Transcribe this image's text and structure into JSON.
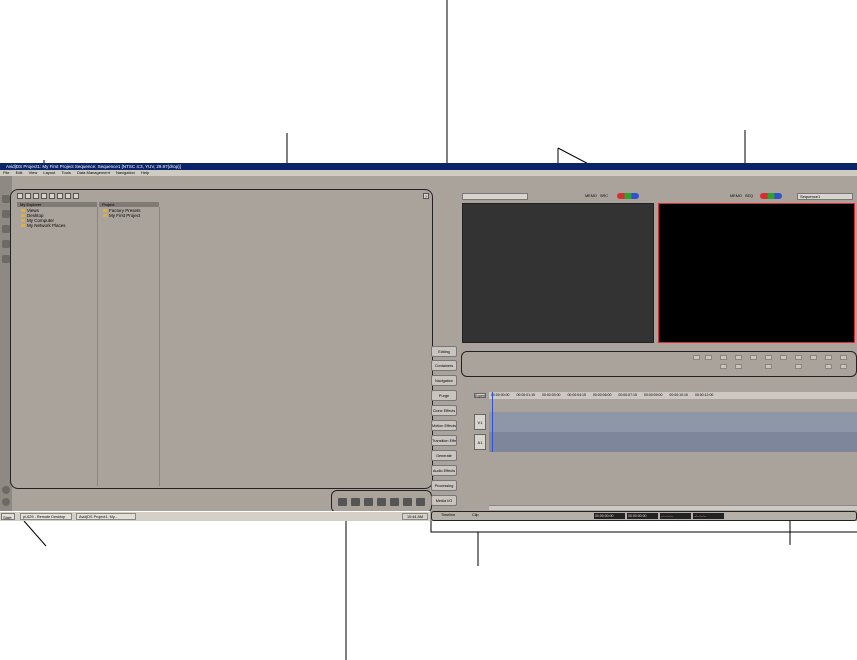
{
  "window": {
    "title": "Avid|DS Project1: My First Project   Sequence: Sequence1   [NTSC 4:3, YUV, 29.97(drop)]"
  },
  "menu": [
    "File",
    "Edit",
    "View",
    "Layout",
    "Tools",
    "Data Management",
    "Navigation",
    "Help"
  ],
  "project_panel": {
    "columns": [
      "My Explorer",
      "Project"
    ],
    "explorer_items": [
      "Views",
      "Desktop",
      "My Computer",
      "My Network Places"
    ],
    "project_items": [
      "Factory Presets",
      "My First Project"
    ],
    "help_label": "?"
  },
  "command_buttons": [
    "Editing",
    "Containers",
    "Navigation",
    "Purge",
    "Clone Effects",
    "Motion Effects",
    "Transition Effects",
    "Generate",
    "Audio Effects",
    "Processing",
    "Media I/O"
  ],
  "monitors": {
    "sequence_name": "Sequence1",
    "header_labels": [
      "MEMO",
      "SRC",
      "MEMO",
      "SEQ"
    ]
  },
  "timeline": {
    "expert_label": "Expert",
    "tracks": [
      "V1",
      "A1"
    ],
    "ruler_timecodes": [
      "00:00:00:00",
      "00:00:01:15",
      "00:00:03:00",
      "00:00:04:15",
      "00:00:06:00",
      "00:00:07:15",
      "00:00:09:00",
      "00:00:10:15",
      "00:00:12:00"
    ],
    "bottom_tabs": [
      "Timeline",
      "Clip"
    ],
    "timecodes": [
      "00:00:00:00",
      "00:00:00:00",
      "--:--:--:--",
      "--:--:--:--"
    ]
  },
  "taskbar": {
    "start_label": "Start",
    "buttons": [
      "pl-629 - Remote Desktop",
      "Avid|DS Project1: My..."
    ],
    "clock": "10:44 AM"
  },
  "colors": {
    "title_bar": "#0a246a",
    "app_bg": "#a9a39b",
    "monitor": "#333333",
    "record_monitor": "#000000",
    "record_border": "#d43030"
  }
}
